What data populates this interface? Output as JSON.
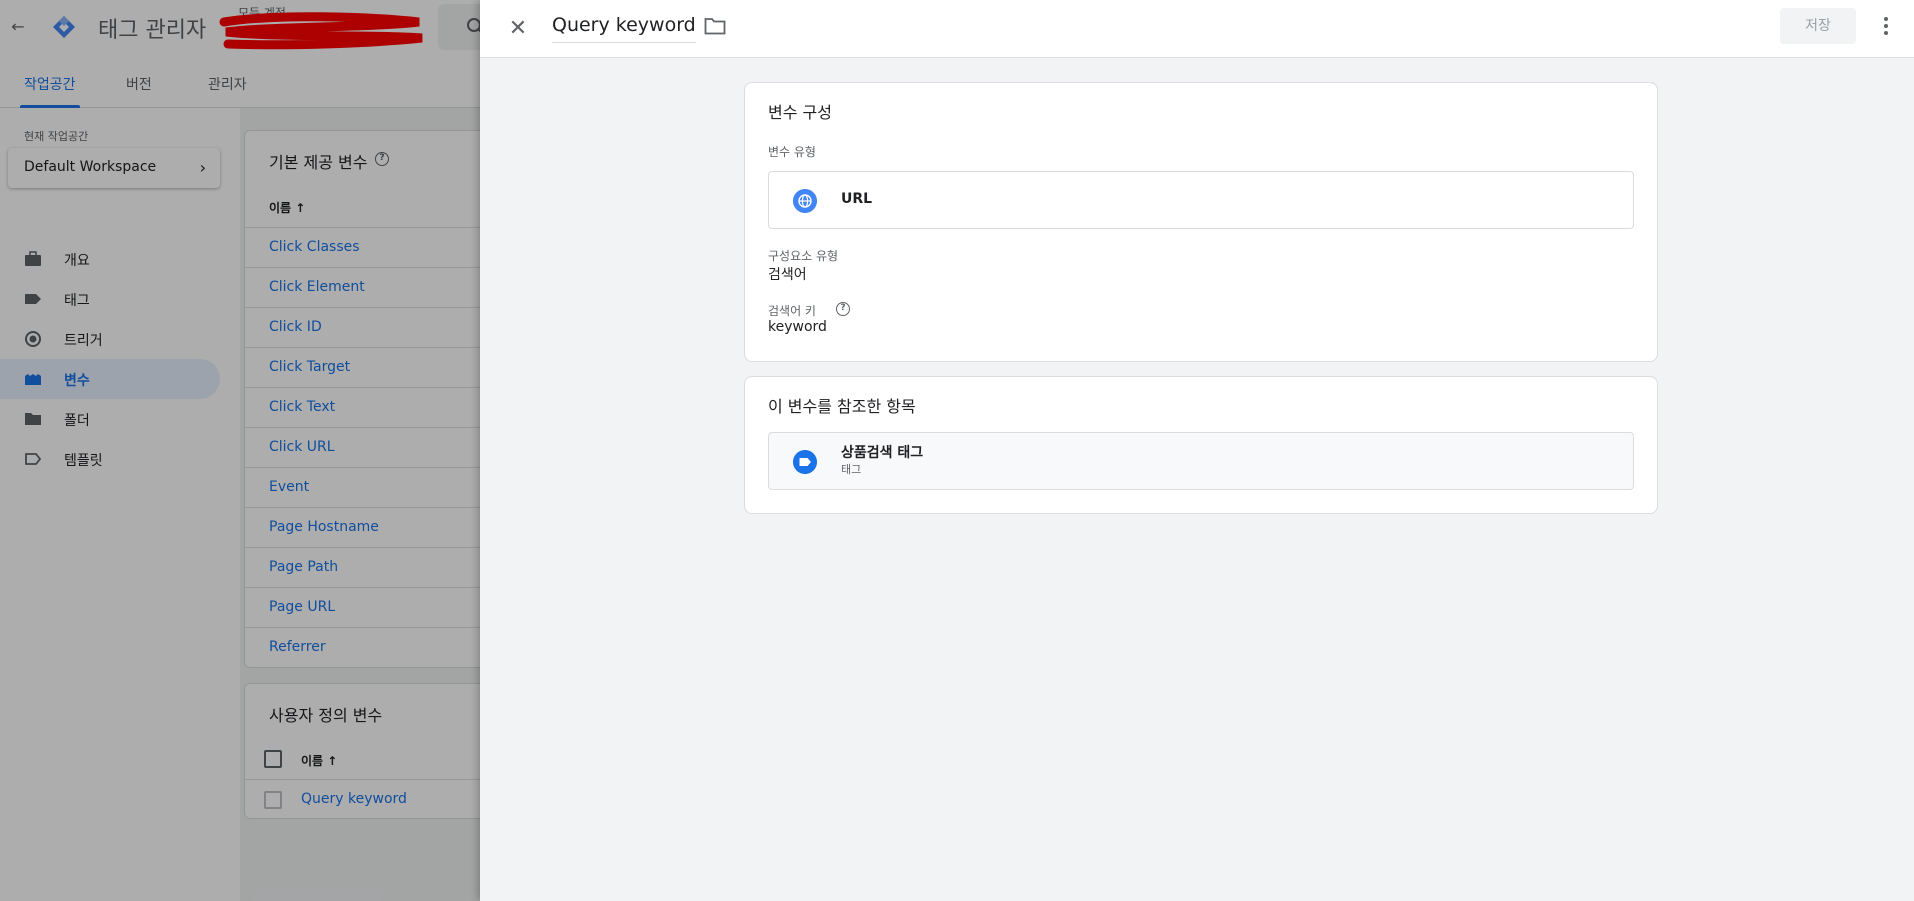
{
  "app": {
    "title": "태그 관리자",
    "account_label": "모든 계정",
    "tabs": [
      {
        "label": "작업공간",
        "active": true
      },
      {
        "label": "버전",
        "active": false
      },
      {
        "label": "관리자",
        "active": false
      }
    ]
  },
  "workspace": {
    "label": "현재 작업공간",
    "name": "Default Workspace"
  },
  "nav": {
    "items": [
      {
        "label": "개요",
        "icon": "briefcase-icon",
        "active": false
      },
      {
        "label": "태그",
        "icon": "tag-icon",
        "active": false
      },
      {
        "label": "트리거",
        "icon": "trigger-icon",
        "active": false
      },
      {
        "label": "변수",
        "icon": "variable-icon",
        "active": true
      },
      {
        "label": "폴더",
        "icon": "folder-icon",
        "active": false
      },
      {
        "label": "템플릿",
        "icon": "template-icon",
        "active": false
      }
    ]
  },
  "builtin_vars": {
    "title": "기본 제공 변수",
    "column": "이름",
    "rows": [
      "Click Classes",
      "Click Element",
      "Click ID",
      "Click Target",
      "Click Text",
      "Click URL",
      "Event",
      "Page Hostname",
      "Page Path",
      "Page URL",
      "Referrer"
    ]
  },
  "user_vars": {
    "title": "사용자 정의 변수",
    "column": "이름",
    "rows": [
      "Query keyword"
    ]
  },
  "panel": {
    "variable_name": "Query keyword",
    "save_label": "저장",
    "config": {
      "title": "변수 구성",
      "type_label": "변수 유형",
      "type_value": "URL",
      "component_label": "구성요소 유형",
      "component_value": "검색어",
      "key_label": "검색어 키",
      "key_value": "keyword"
    },
    "references": {
      "title": "이 변수를 참조한 항목",
      "item_name": "상품검색 태그",
      "item_type": "태그"
    }
  },
  "colors": {
    "accent": "#1a73e8",
    "icon_blue": "#4285f4",
    "redaction": "#ff0000"
  }
}
